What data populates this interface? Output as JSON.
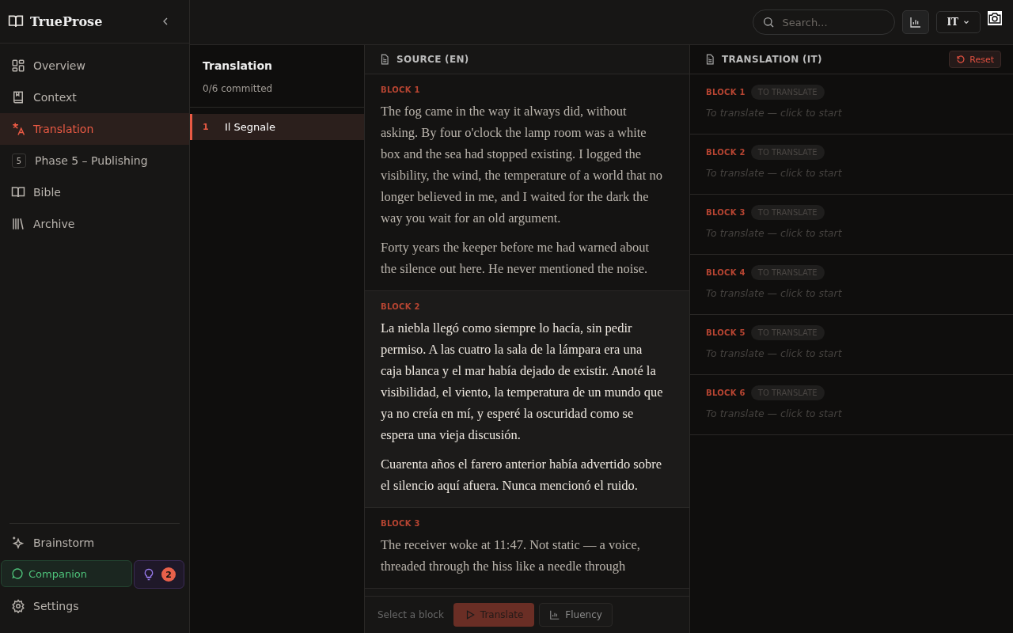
{
  "brand": "TrueProse",
  "nav": [
    {
      "kind": "grid",
      "label": "Overview",
      "selected": false
    },
    {
      "kind": "book",
      "label": "Context",
      "selected": false
    },
    {
      "kind": "translate",
      "label": "Translation",
      "selected": true
    },
    {
      "kind": "number",
      "badge": "5",
      "label": "Phase 5 – Publishing",
      "selected": false
    },
    {
      "kind": "open-book",
      "label": "Bible",
      "selected": false
    },
    {
      "kind": "library",
      "label": "Archive",
      "selected": false
    }
  ],
  "sidebar_bottom": {
    "brainstorm": "Brainstorm",
    "companion": "Companion",
    "ideas_count": "2",
    "settings": "Settings"
  },
  "topbar": {
    "search_placeholder": "Search...",
    "language": "IT"
  },
  "chapters": {
    "title": "Translation",
    "progress": "0/6 committed",
    "items": [
      {
        "number": "1",
        "title": "Il Segnale",
        "selected": true
      }
    ]
  },
  "source": {
    "title": "SOURCE (EN)",
    "blocks": [
      {
        "label": "BLOCK 1",
        "selected": false,
        "paragraphs": [
          "The fog came in the way it always did, without asking. By four o'clock the lamp room was a white box and the sea had stopped existing. I logged the visibility, the wind, the temperature of a world that no longer believed in me, and I waited for the dark the way you wait for an old argument.",
          "Forty years the keeper before me had warned about the silence out here. He never mentioned the noise."
        ]
      },
      {
        "label": "BLOCK 2",
        "selected": true,
        "paragraphs": [
          "La niebla llegó como siempre lo hacía, sin pedir permiso. A las cuatro la sala de la lámpara era una caja blanca y el mar había dejado de existir. Anoté la visibilidad, el viento, la temperatura de un mundo que ya no creía en mí, y esperé la oscuridad como se espera una vieja discusión.",
          "Cuarenta años el farero anterior había advertido sobre el silencio aquí afuera. Nunca mencionó el ruido."
        ]
      },
      {
        "label": "BLOCK 3",
        "selected": false,
        "paragraphs": [
          "The receiver woke at 11:47. Not static — a voice, threaded through the hiss like a needle through"
        ]
      }
    ]
  },
  "footer": {
    "hint": "Select a block",
    "translate": "Translate",
    "fluency": "Fluency"
  },
  "translation": {
    "title": "TRANSLATION (IT)",
    "reset": "Reset",
    "blocks": [
      {
        "label": "BLOCK 1",
        "status": "TO TRANSLATE",
        "placeholder": "To translate — click to start"
      },
      {
        "label": "BLOCK 2",
        "status": "TO TRANSLATE",
        "placeholder": "To translate — click to start"
      },
      {
        "label": "BLOCK 3",
        "status": "TO TRANSLATE",
        "placeholder": "To translate — click to start"
      },
      {
        "label": "BLOCK 4",
        "status": "TO TRANSLATE",
        "placeholder": "To translate — click to start"
      },
      {
        "label": "BLOCK 5",
        "status": "TO TRANSLATE",
        "placeholder": "To translate — click to start"
      },
      {
        "label": "BLOCK 6",
        "status": "TO TRANSLATE",
        "placeholder": "To translate — click to start"
      }
    ]
  }
}
